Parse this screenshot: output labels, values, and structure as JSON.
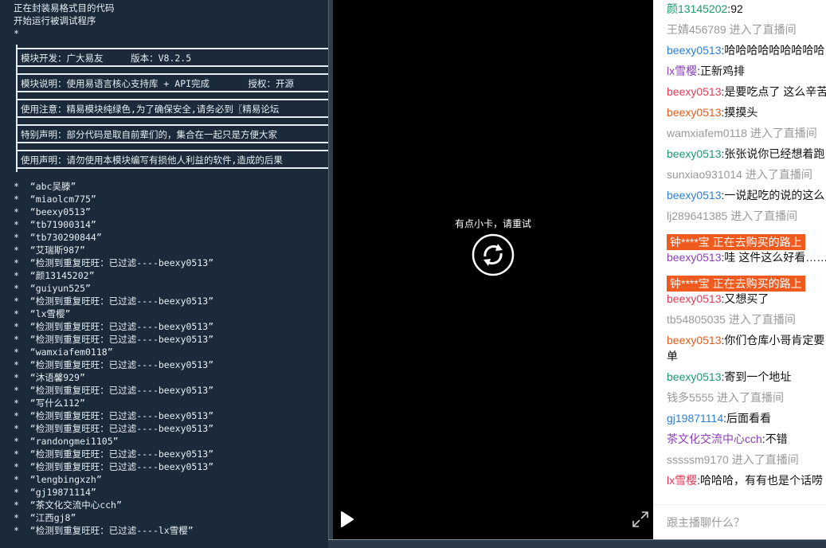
{
  "console": {
    "header_lines": [
      "正在封装易格式目的代码",
      "开始运行被调试程序",
      "*"
    ],
    "boxes": [
      "模块开发：广大易友     版本：V8.2.5",
      "模块说明：使用易语言核心支持库 + API完成       授权：开源",
      "使用注意：精易模块纯绿色,为了确保安全,请务必到〖精易论坛",
      "特别声明：部分代码是取自前辈们的，集合在一起只是方便大家",
      "使用声明：请勿使用本模块编写有损他人利益的软件,造成的后果"
    ],
    "log_lines": [
      "*  “abc吴滕”",
      "*  “miaolcm775”",
      "*  “beexy0513”",
      "*  “tb71900314”",
      "*  “tb730290844”",
      "*  “艾瑞斯987”",
      "*  “检测到重复旺旺：已过滤----beexy0513”",
      "*  “颜13145202”",
      "*  “guiyun525”",
      "*  “检测到重复旺旺：已过滤----beexy0513”",
      "*  “lx雪樱”",
      "*  “检测到重复旺旺：已过滤----beexy0513”",
      "*  “检测到重复旺旺：已过滤----beexy0513”",
      "*  “wamxiafem0118”",
      "*  “检测到重复旺旺：已过滤----beexy0513”",
      "*  “沐语馨929”",
      "*  “检测到重复旺旺：已过滤----beexy0513”",
      "*  “写什么112”",
      "*  “检测到重复旺旺：已过滤----beexy0513”",
      "*  “检测到重复旺旺：已过滤----beexy0513”",
      "*  “randongmei1105”",
      "*  “检测到重复旺旺：已过滤----beexy0513”",
      "*  “检测到重复旺旺：已过滤----beexy0513”",
      "*  “lengbingxzh”",
      "*  “gj19871114”",
      "*  “茶文化交流中心cch”",
      "*  “江西gj8”",
      "*  “检测到重复旺旺：已过滤----lx雪樱”"
    ]
  },
  "video": {
    "stall_text": "有点小卡，请重试",
    "icons": [
      "reload-icon",
      "play-icon",
      "fullscreen-icon"
    ]
  },
  "chat": {
    "colors": {
      "green": "#1a9a6c",
      "blue": "#2b7fd6",
      "purple": "#8a3fb8",
      "red": "#e83a57",
      "orange": "#e85a1b",
      "sys": "#999999",
      "buy_bg": "#f05a1e"
    },
    "messages": [
      {
        "user": "颜13145202",
        "sep": ":",
        "text": "92",
        "color": "green"
      },
      {
        "user": "王婧456789",
        "sep": " ",
        "text": "进入了直播间",
        "color": "sys"
      },
      {
        "user": "beexy0513",
        "sep": ":",
        "text": "哈哈哈哈哈哈哈哈哈",
        "color": "blue"
      },
      {
        "user": "lx雪樱",
        "sep": ":",
        "text": "正新鸡排",
        "color": "purple"
      },
      {
        "user": "beexy0513",
        "sep": ":",
        "text": "是要吃点了 这么辛苦",
        "color": "red"
      },
      {
        "user": "beexy0513",
        "sep": ":",
        "text": "摸摸头",
        "color": "orange"
      },
      {
        "user": "wamxiafem0118",
        "sep": " ",
        "text": "进入了直播间",
        "color": "sys"
      },
      {
        "user": "beexy0513",
        "sep": ":",
        "text": "张张说你已经想着跑",
        "color": "green"
      },
      {
        "user": "sunxiao931014",
        "sep": " ",
        "text": "进入了直播间",
        "color": "sys"
      },
      {
        "user": "beexy0513",
        "sep": ":",
        "text": "一说起吃的说的这么",
        "color": "blue"
      },
      {
        "user": "lj289641385",
        "sep": " ",
        "text": "进入了直播间",
        "color": "sys"
      },
      {
        "buy": "钟****宝 正在去购买的路上"
      },
      {
        "user": "beexy0513",
        "sep": ":",
        "text": "哇 这件这么好看……",
        "color": "purple"
      },
      {
        "buy": "钟****宝 正在去购买的路上"
      },
      {
        "user": "beexy0513",
        "sep": ":",
        "text": "又想买了",
        "color": "red"
      },
      {
        "user": "tb54805035",
        "sep": " ",
        "text": "进入了直播间",
        "color": "sys"
      },
      {
        "user": "beexy0513",
        "sep": ":",
        "text": "你们仓库小哥肯定要单",
        "color": "orange",
        "tall": true
      },
      {
        "user": "beexy0513",
        "sep": ":",
        "text": "寄到一个地址",
        "color": "green"
      },
      {
        "user": "钱多5555",
        "sep": " ",
        "text": "进入了直播间",
        "color": "sys"
      },
      {
        "user": "gj19871114",
        "sep": ":",
        "text": "后面看看",
        "color": "blue"
      },
      {
        "user": "茶文化交流中心cch",
        "sep": ":",
        "text": "不错",
        "color": "purple"
      },
      {
        "user": "sssssm9170",
        "sep": " ",
        "text": "进入了直播间",
        "color": "sys"
      },
      {
        "user": "lx雪樱",
        "sep": ":",
        "text": "哈哈哈，有有也是个话唠",
        "color": "red"
      }
    ],
    "input_placeholder": "跟主播聊什么？"
  }
}
